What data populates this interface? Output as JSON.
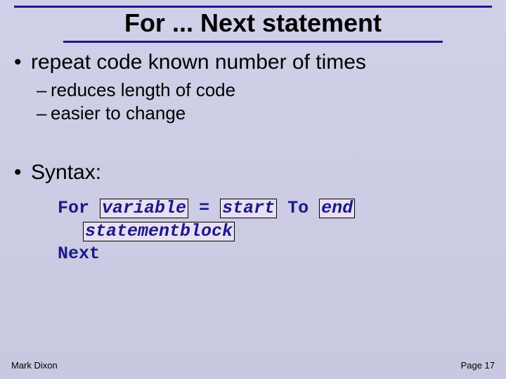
{
  "title": "For ... Next statement",
  "bullets": {
    "b1a": "repeat code known number of times",
    "b2a": "reduces length of code",
    "b2b": "easier to change",
    "b1b": "Syntax:"
  },
  "code": {
    "kw_for": "For",
    "var": "variable",
    "eq": "=",
    "start": "start",
    "kw_to": "To",
    "end": "end",
    "stmt": "statementblock",
    "kw_next": "Next"
  },
  "footer": {
    "author": "Mark Dixon",
    "page": "Page 17"
  }
}
